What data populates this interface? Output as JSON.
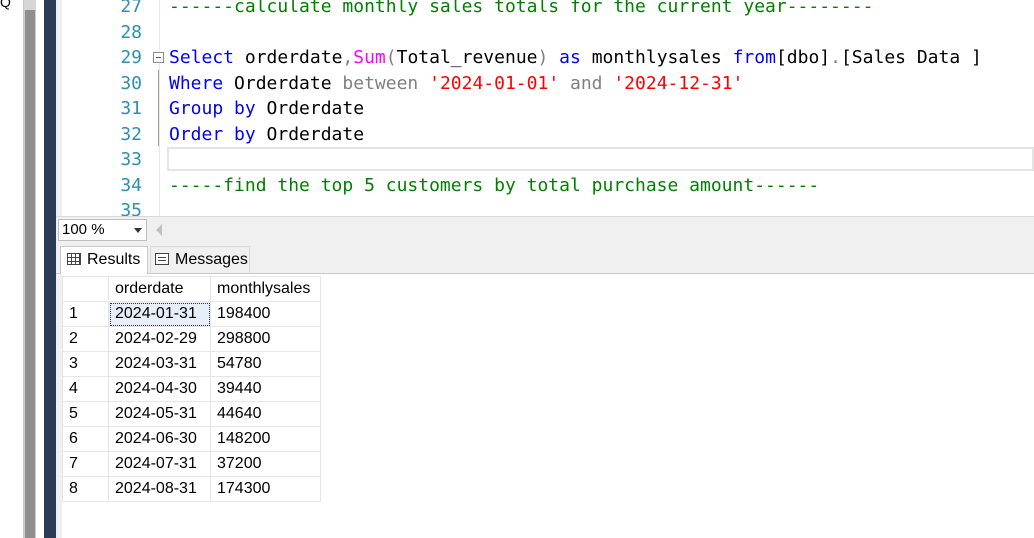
{
  "left_pane": {
    "text": "Q"
  },
  "editor": {
    "lines": [
      {
        "num": "27",
        "segments": [
          {
            "t": "------calculate monthly sales totals for the current year--------",
            "c": "cmt"
          }
        ]
      },
      {
        "num": "28",
        "segments": []
      },
      {
        "num": "29",
        "fold": true,
        "segments": [
          {
            "t": "Select",
            "c": "kw"
          },
          {
            "t": " orderdate",
            "c": "plain"
          },
          {
            "t": ",",
            "c": "gray"
          },
          {
            "t": "Sum",
            "c": "fn"
          },
          {
            "t": "(",
            "c": "gray"
          },
          {
            "t": "Total_revenue",
            "c": "plain"
          },
          {
            "t": ")",
            "c": "gray"
          },
          {
            "t": " as",
            "c": "kw"
          },
          {
            "t": " monthlysales ",
            "c": "plain"
          },
          {
            "t": "from",
            "c": "kw"
          },
          {
            "t": "[dbo]",
            "c": "plain"
          },
          {
            "t": ".",
            "c": "gray"
          },
          {
            "t": "[Sales Data ]",
            "c": "plain"
          }
        ]
      },
      {
        "num": "30",
        "segments": [
          {
            "t": "Where",
            "c": "kw"
          },
          {
            "t": " Orderdate ",
            "c": "plain"
          },
          {
            "t": "between",
            "c": "gray"
          },
          {
            "t": " ",
            "c": "plain"
          },
          {
            "t": "'2024-01-01'",
            "c": "str"
          },
          {
            "t": " and ",
            "c": "gray"
          },
          {
            "t": "'2024-12-31'",
            "c": "str"
          }
        ]
      },
      {
        "num": "31",
        "segments": [
          {
            "t": "Group by",
            "c": "kw"
          },
          {
            "t": " Orderdate",
            "c": "plain"
          }
        ]
      },
      {
        "num": "32",
        "segments": [
          {
            "t": "Order by",
            "c": "kw"
          },
          {
            "t": " Orderdate",
            "c": "plain"
          }
        ]
      },
      {
        "num": "33",
        "segments": []
      },
      {
        "num": "34",
        "segments": [
          {
            "t": "-----find the top 5 customers by total purchase amount------",
            "c": "cmt"
          }
        ]
      },
      {
        "num": "35",
        "segments": []
      }
    ]
  },
  "zoom": {
    "value": "100 %"
  },
  "tabs": {
    "results": "Results",
    "messages": "Messages"
  },
  "results": {
    "columns": [
      "orderdate",
      "monthlysales"
    ],
    "rows": [
      [
        "1",
        "2024-01-31",
        "198400"
      ],
      [
        "2",
        "2024-02-29",
        "298800"
      ],
      [
        "3",
        "2024-03-31",
        "54780"
      ],
      [
        "4",
        "2024-04-30",
        "39440"
      ],
      [
        "5",
        "2024-05-31",
        "44640"
      ],
      [
        "6",
        "2024-06-30",
        "148200"
      ],
      [
        "7",
        "2024-07-31",
        "37200"
      ],
      [
        "8",
        "2024-08-31",
        "174300"
      ]
    ]
  },
  "colors": {
    "keyword": "#0000ff",
    "function": "#ff00ff",
    "string": "#ff0000",
    "comment": "#008000",
    "line_number": "#2b91af"
  }
}
